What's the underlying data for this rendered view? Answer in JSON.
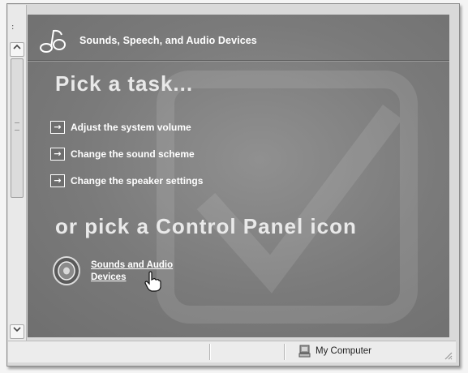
{
  "header": {
    "title": "Sounds, Speech, and Audio Devices",
    "logo_icon": "music-note-icon"
  },
  "main": {
    "pick_task_heading": "Pick a task...",
    "tasks": [
      {
        "label": "Adjust the system volume",
        "icon": "arrow-right-icon"
      },
      {
        "label": "Change the sound scheme",
        "icon": "arrow-right-icon"
      },
      {
        "label": "Change the speaker settings",
        "icon": "arrow-right-icon"
      }
    ],
    "or_pick_heading": "or pick a Control Panel icon",
    "control_panel_icons": [
      {
        "label": "Sounds and Audio Devices",
        "icon": "speaker-icon"
      }
    ]
  },
  "statusbar": {
    "zone_label": "My Computer",
    "zone_icon": "computer-icon"
  },
  "colors": {
    "panel_bg": "#7a7a7a",
    "heading_text": "#e9e9e9",
    "link_text": "#ffffff",
    "statusbar_bg": "#ececec"
  }
}
